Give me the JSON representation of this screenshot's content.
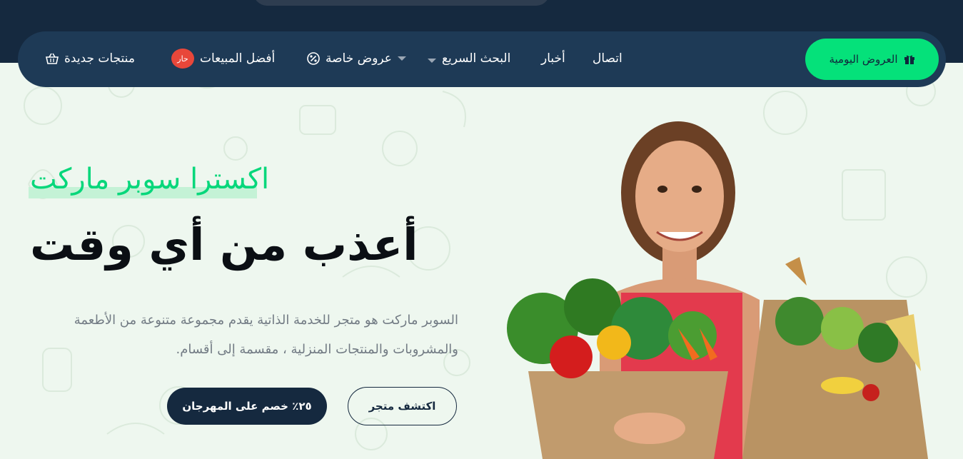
{
  "header": {
    "nav": {
      "daily_deals": "العروض اليومية",
      "contact": "اتصال",
      "news": "أخبار",
      "quick_search": "البحث السريع",
      "special_offers": "عروض خاصة",
      "best_sellers": "أفضل المبيعات",
      "hot_badge": "حار",
      "new_products": "منتجات جديدة"
    },
    "icons": [
      "gift-icon",
      "chevron-down-icon",
      "percent-icon",
      "basket-icon"
    ]
  },
  "hero": {
    "subtitle": "اكسترا سوبر ماركت",
    "headline": "أعذب من أي وقت",
    "description_line1": "السوبر ماركت هو متجر للخدمة الذاتية يقدم مجموعة متنوعة من الأطعمة",
    "description_line2": "والمشروبات والمنتجات المنزلية ، مقسمة إلى أقسام.",
    "primary_button": "٢٥٪ خصم على المهرجان",
    "secondary_button": "اكتشف متجر"
  },
  "colors": {
    "navy": "#15293f",
    "nav_bar": "#1e3a56",
    "accent_green": "#05e17a",
    "hot_red": "#e8473a",
    "background": "#eef7ef"
  }
}
